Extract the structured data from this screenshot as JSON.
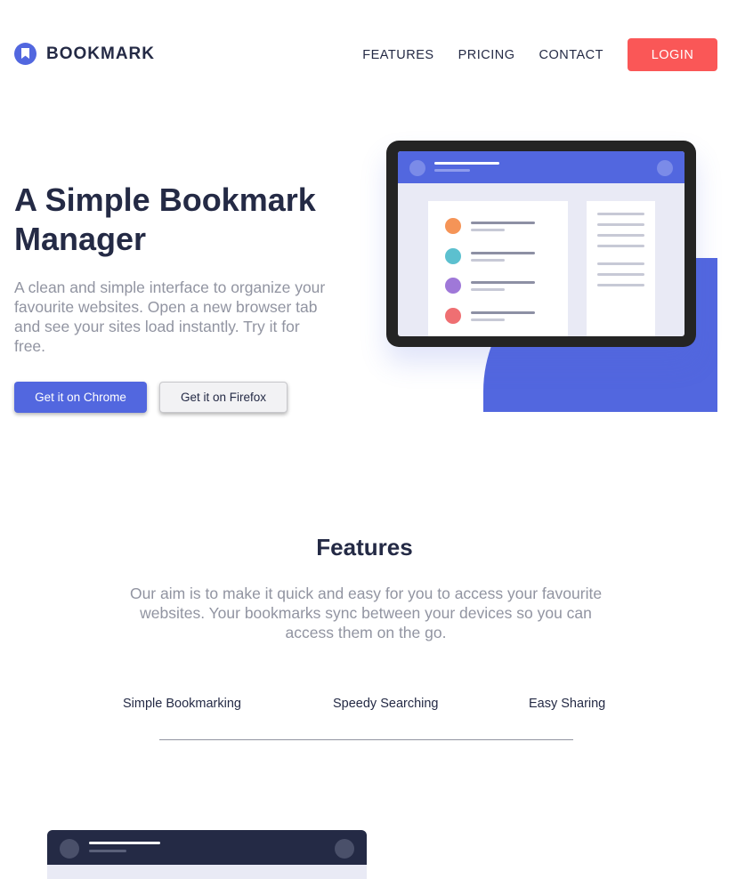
{
  "brand": {
    "name": "BOOKMARK",
    "logo_icon": "bookmark-logo-icon",
    "accent": "#5267df",
    "danger": "#fa5757",
    "dark": "#242a45",
    "muted": "#9194a1"
  },
  "nav": {
    "links": [
      "FEATURES",
      "PRICING",
      "CONTACT"
    ],
    "login_label": "LOGIN"
  },
  "hero": {
    "title": "A Simple Bookmark Manager",
    "description": "A clean and simple interface to organize your favourite websites. Open a new browser tab and see your sites load instantly. Try it for free.",
    "chrome_button": "Get it on Chrome",
    "firefox_button": "Get it on Firefox",
    "illustration": "tablet-bookmark-illustration",
    "bookmark_dot_colors": [
      "#f59457",
      "#5cc0cf",
      "#9f78d8",
      "#ef6f72"
    ]
  },
  "features": {
    "title": "Features",
    "description": "Our aim is to make it quick and easy for you to access your favourite websites. Your bookmarks sync between your devices so you can access them on the go.",
    "tabs": [
      "Simple Bookmarking",
      "Speedy Searching",
      "Easy Sharing"
    ]
  }
}
